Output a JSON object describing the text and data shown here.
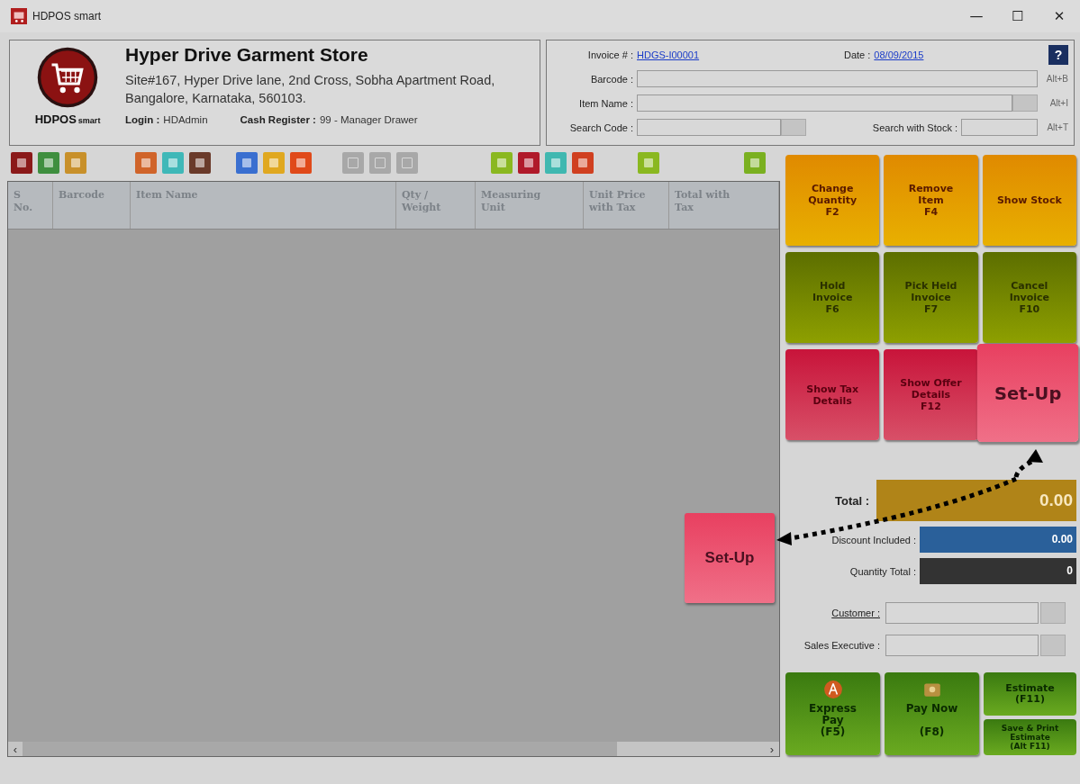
{
  "window": {
    "title": "HDPOS smart",
    "controls": [
      "—",
      "☐",
      "✕"
    ]
  },
  "store": {
    "logo_text": "HDPOS",
    "logo_suffix": "smart",
    "name": "Hyper Drive Garment Store",
    "address": "Site#167, Hyper Drive lane, 2nd Cross, Sobha Apartment Road, Bangalore, Karnataka, 560103.",
    "login_label": "Login :",
    "login_value": "HDAdmin",
    "register_label": "Cash Register :",
    "register_value": "99 - Manager Drawer"
  },
  "invoice": {
    "invoice_label": "Invoice # :",
    "invoice_no": "HDGS-I00001",
    "date_label": "Date :",
    "date": "08/09/2015",
    "help": "?",
    "rows": [
      {
        "kind": "wide",
        "label": "Barcode :",
        "browse": false,
        "shortcut": "Alt+B"
      },
      {
        "kind": "wide",
        "label": "Item Name :",
        "browse": true,
        "shortcut": "Alt+I"
      },
      {
        "kind": "split",
        "label": "Search Code :",
        "browse": true,
        "label2": "Search with Stock :",
        "shortcut": "Alt+T"
      }
    ]
  },
  "toolbar": [
    [
      {
        "color": "#8b1a1a",
        "disabled": false
      },
      {
        "color": "#3f8f3f",
        "disabled": false
      },
      {
        "color": "#c8902a",
        "disabled": false
      }
    ],
    [
      {
        "color": "#d0642a",
        "disabled": false
      },
      {
        "color": "#3fb8b8",
        "disabled": false
      },
      {
        "color": "#6a3a2a",
        "disabled": false
      }
    ],
    [
      {
        "color": "#3a6fd0",
        "disabled": false
      },
      {
        "color": "#e0a820",
        "disabled": false
      },
      {
        "color": "#e04a1a",
        "disabled": false
      }
    ],
    [
      {
        "color": "#a8a8a8",
        "disabled": true
      },
      {
        "color": "#a8a8a8",
        "disabled": true
      },
      {
        "color": "#a8a8a8",
        "disabled": true
      }
    ],
    [
      {
        "color": "#8ab820",
        "disabled": false
      },
      {
        "color": "#b01a2a",
        "disabled": false
      },
      {
        "color": "#40b8b0",
        "disabled": false
      },
      {
        "color": "#d04020",
        "disabled": false
      }
    ],
    [
      {
        "color": "#8ab820",
        "disabled": false
      }
    ],
    [
      {
        "color": "#7ab020",
        "disabled": false
      }
    ]
  ],
  "table": {
    "columns": [
      "S\nNo.",
      "Barcode",
      "Item Name",
      "Qty /\nWeight",
      "Measuring\nUnit",
      "Unit Price\nwith Tax",
      "Total with\nTax"
    ],
    "scroll_left": "‹",
    "scroll_right": "›"
  },
  "actions": [
    {
      "label": "Change\nQuantity\nF2",
      "kind": "orange",
      "highlighted": false
    },
    {
      "label": "Remove\nItem\nF4",
      "kind": "orange",
      "highlighted": false
    },
    {
      "label": "Show Stock",
      "kind": "orange",
      "highlighted": false
    },
    {
      "label": "Hold\nInvoice\nF6",
      "kind": "olive",
      "highlighted": false
    },
    {
      "label": "Pick Held\nInvoice\nF7",
      "kind": "olive",
      "highlighted": false
    },
    {
      "label": "Cancel\nInvoice\nF10",
      "kind": "olive",
      "highlighted": false
    },
    {
      "label": "Show Tax\nDetails",
      "kind": "red",
      "highlighted": false
    },
    {
      "label": "Show Offer\nDetails\nF12",
      "kind": "red",
      "highlighted": false
    },
    {
      "label": "Set-Up",
      "kind": "pink",
      "highlighted": true
    }
  ],
  "callout": {
    "label": "Set-Up"
  },
  "totals": [
    {
      "kind": "total",
      "label": "Total :",
      "value": "0.00"
    },
    {
      "kind": "discount",
      "label": "Discount Included :",
      "value": "0.00"
    },
    {
      "kind": "quantity",
      "label": "Quantity Total :",
      "value": "0"
    }
  ],
  "people": [
    {
      "label": "Customer :",
      "link": true
    },
    {
      "label": "Sales Executive :",
      "link": false
    }
  ],
  "pay_buttons": [
    {
      "kind": "express",
      "label": "Express\nPay\n(F5)"
    },
    {
      "kind": "paynow",
      "label": "Pay Now\n\n(F8)"
    }
  ],
  "estimate_buttons": [
    {
      "label": "Estimate\n(F11)"
    },
    {
      "label": "Save & Print\nEstimate\n(Alt F11)"
    }
  ]
}
